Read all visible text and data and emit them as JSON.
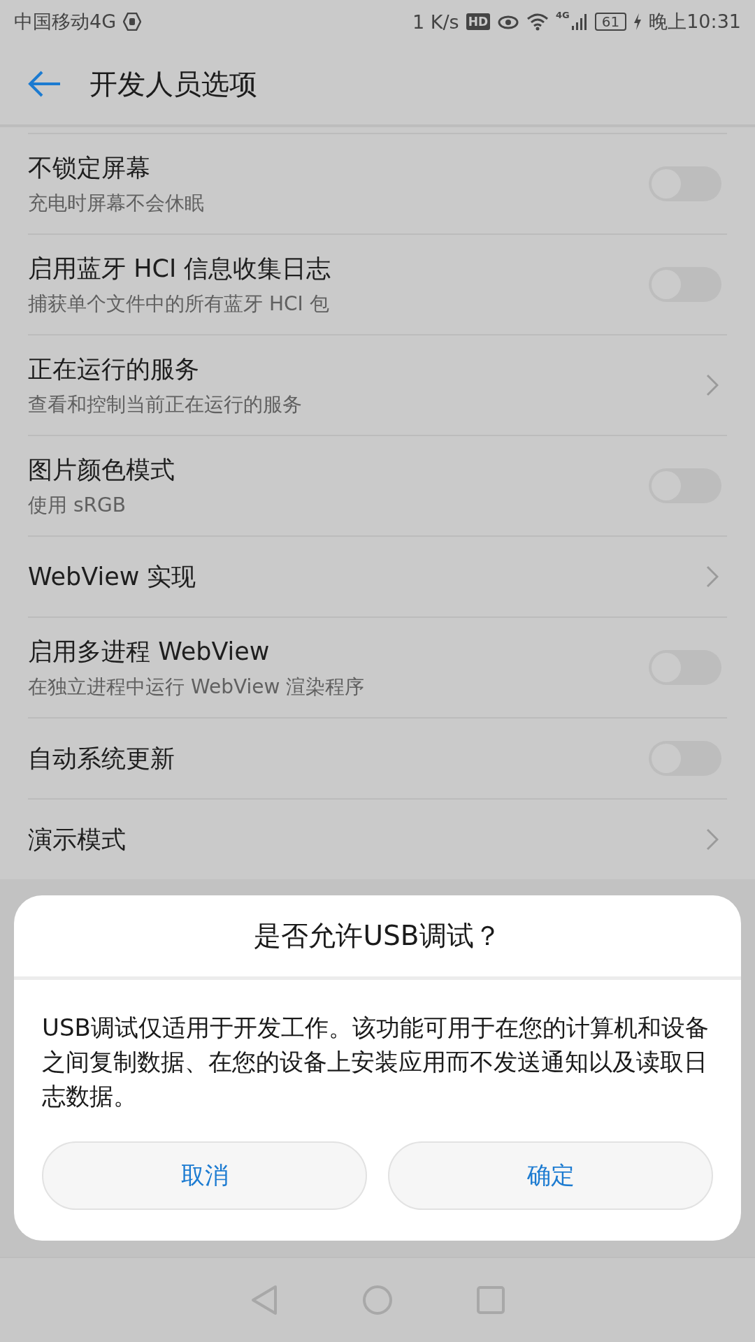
{
  "status_bar": {
    "carrier": "中国移动4G",
    "speed": "1 K/s",
    "hd_badge": "HD",
    "network_badge": "4G",
    "battery": "61",
    "time": "晚上10:31"
  },
  "app_bar": {
    "title": "开发人员选项"
  },
  "settings": [
    {
      "kind": "toggle",
      "title": "不锁定屏幕",
      "subtitle": "充电时屏幕不会休眠",
      "on": false
    },
    {
      "kind": "toggle",
      "title": "启用蓝牙 HCI 信息收集日志",
      "subtitle": "捕获单个文件中的所有蓝牙 HCI 包",
      "on": false
    },
    {
      "kind": "link",
      "title": "正在运行的服务",
      "subtitle": "查看和控制当前正在运行的服务"
    },
    {
      "kind": "toggle",
      "title": "图片颜色模式",
      "subtitle": "使用 sRGB",
      "on": false
    },
    {
      "kind": "link",
      "title": "WebView 实现"
    },
    {
      "kind": "toggle",
      "title": "启用多进程 WebView",
      "subtitle": "在独立进程中运行 WebView 渲染程序",
      "on": false
    },
    {
      "kind": "toggle",
      "title": "自动系统更新",
      "on": false
    },
    {
      "kind": "link",
      "title": "演示模式"
    }
  ],
  "dialog": {
    "title": "是否允许USB调试？",
    "message": "USB调试仅适用于开发工作。该功能可用于在您的计算机和设备之间复制数据、在您的设备上安装应用而不发送通知以及读取日志数据。",
    "buttons": [
      {
        "label": "取消"
      },
      {
        "label": "确定"
      }
    ]
  }
}
